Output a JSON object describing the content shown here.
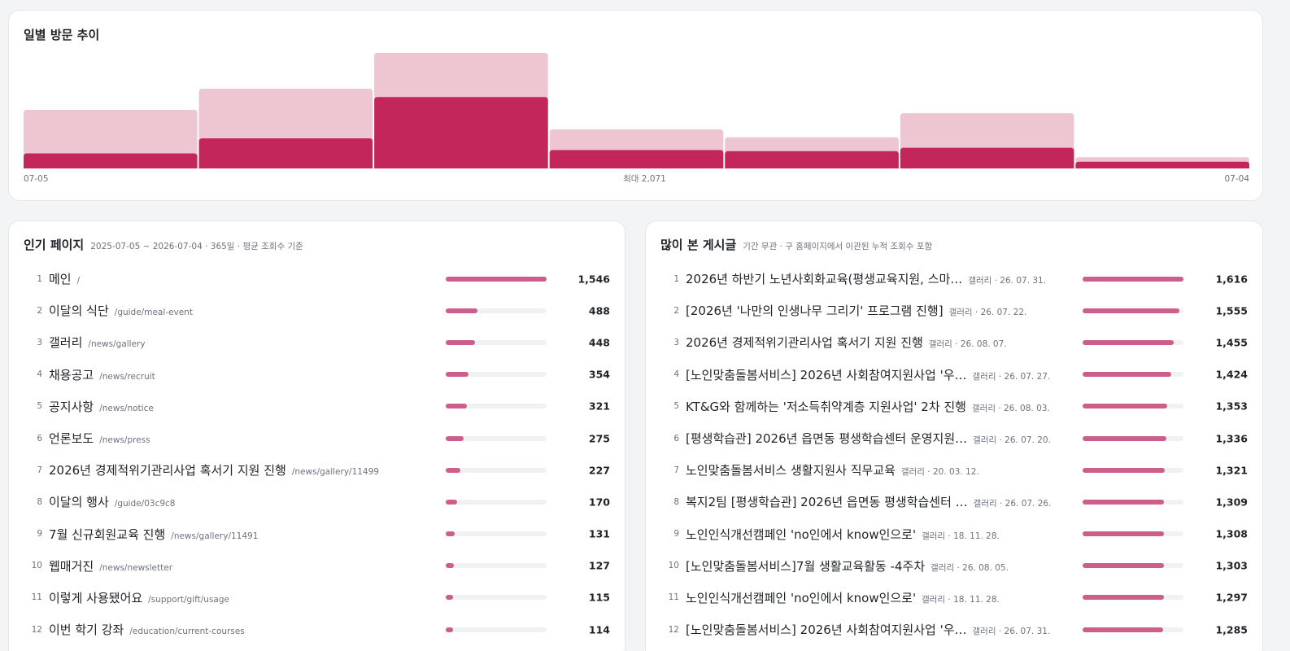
{
  "trend": {
    "title": "일별 방문 추이",
    "start_label": "07-05",
    "end_label": "07-04",
    "max_label": "최대 2,071",
    "colors": {
      "light": "#eec6d2",
      "dark": "#c2265b"
    }
  },
  "chart_data": {
    "type": "bar",
    "title": "일별 방문 추이",
    "ymax": 2071,
    "series": [
      {
        "values": [
          1050,
          1430,
          2071,
          700,
          560,
          990,
          200
        ]
      },
      {
        "values": [
          270,
          540,
          1280,
          330,
          310,
          370,
          120
        ]
      }
    ],
    "x_ticks": [
      "07-05",
      "07-04"
    ],
    "annotation": "최대 2,071"
  },
  "pages": {
    "title": "인기 페이지",
    "subtitle": "2025-07-05 ~ 2026-07-04 · 365일 · 평균 조회수 기준",
    "max": 1546,
    "items": [
      {
        "rank": "1",
        "name": "메인",
        "path": "/",
        "count": "1,546",
        "value": 1546
      },
      {
        "rank": "2",
        "name": "이달의 식단",
        "path": "/guide/meal-event",
        "count": "488",
        "value": 488
      },
      {
        "rank": "3",
        "name": "갤러리",
        "path": "/news/gallery",
        "count": "448",
        "value": 448
      },
      {
        "rank": "4",
        "name": "채용공고",
        "path": "/news/recruit",
        "count": "354",
        "value": 354
      },
      {
        "rank": "5",
        "name": "공지사항",
        "path": "/news/notice",
        "count": "321",
        "value": 321
      },
      {
        "rank": "6",
        "name": "언론보도",
        "path": "/news/press",
        "count": "275",
        "value": 275
      },
      {
        "rank": "7",
        "name": "2026년 경제적위기관리사업 혹서기 지원 진행",
        "path": "/news/gallery/11499",
        "count": "227",
        "value": 227
      },
      {
        "rank": "8",
        "name": "이달의 행사",
        "path": "/guide/03c9c8",
        "count": "170",
        "value": 170
      },
      {
        "rank": "9",
        "name": "7월 신규회원교육 진행",
        "path": "/news/gallery/11491",
        "count": "131",
        "value": 131
      },
      {
        "rank": "10",
        "name": "웹매거진",
        "path": "/news/newsletter",
        "count": "127",
        "value": 127
      },
      {
        "rank": "11",
        "name": "이렇게 사용됐어요",
        "path": "/support/gift/usage",
        "count": "115",
        "value": 115
      },
      {
        "rank": "12",
        "name": "이번 학기 강좌",
        "path": "/education/current-courses",
        "count": "114",
        "value": 114
      }
    ]
  },
  "posts": {
    "title": "많이 본 게시글",
    "subtitle": "기간 무관 · 구 홈페이지에서 이관된 누적 조회수 포함",
    "max": 1616,
    "items": [
      {
        "rank": "1",
        "name": "2026년 하반기 노년사회화교육(평생교육지원, 스마…",
        "meta": "갤러리 · 26. 07. 31.",
        "count": "1,616",
        "value": 1616
      },
      {
        "rank": "2",
        "name": "[2026년 '나만의 인생나무 그리기' 프로그램 진행]",
        "meta": "갤러리 · 26. 07. 22.",
        "count": "1,555",
        "value": 1555
      },
      {
        "rank": "3",
        "name": "2026년 경제적위기관리사업 혹서기 지원 진행",
        "meta": "갤러리 · 26. 08. 07.",
        "count": "1,455",
        "value": 1455
      },
      {
        "rank": "4",
        "name": "[노인맞춤돌봄서비스] 2026년 사회참여지원사업 '우…",
        "meta": "갤러리 · 26. 07. 27.",
        "count": "1,424",
        "value": 1424
      },
      {
        "rank": "5",
        "name": "KT&G와 함께하는 '저소득취약계층 지원사업' 2차 진행",
        "meta": "갤러리 · 26. 08. 03.",
        "count": "1,353",
        "value": 1353
      },
      {
        "rank": "6",
        "name": "[평생학습관] 2026년 읍면동 평생학습센터 운영지원…",
        "meta": "갤러리 · 26. 07. 20.",
        "count": "1,336",
        "value": 1336
      },
      {
        "rank": "7",
        "name": "노인맞춤돌봄서비스 생활지원사 직무교육",
        "meta": "갤러리 · 20. 03. 12.",
        "count": "1,321",
        "value": 1321
      },
      {
        "rank": "8",
        "name": "복지2팀 [평생학습관] 2026년 읍면동 평생학습센터 …",
        "meta": "갤러리 · 26. 07. 26.",
        "count": "1,309",
        "value": 1309
      },
      {
        "rank": "9",
        "name": "노인인식개선캠페인 'no인에서 know인으로'",
        "meta": "갤러리 · 18. 11. 28.",
        "count": "1,308",
        "value": 1308
      },
      {
        "rank": "10",
        "name": "[노인맞춤돌봄서비스]7월 생활교육활동 -4주차",
        "meta": "갤러리 · 26. 08. 05.",
        "count": "1,303",
        "value": 1303
      },
      {
        "rank": "11",
        "name": "노인인식개선캠페인 'no인에서 know인으로'",
        "meta": "갤러리 · 18. 11. 28.",
        "count": "1,297",
        "value": 1297
      },
      {
        "rank": "12",
        "name": "[노인맞춤돌봄서비스] 2026년 사회참여지원사업 '우…",
        "meta": "갤러리 · 26. 07. 31.",
        "count": "1,285",
        "value": 1285
      }
    ]
  }
}
